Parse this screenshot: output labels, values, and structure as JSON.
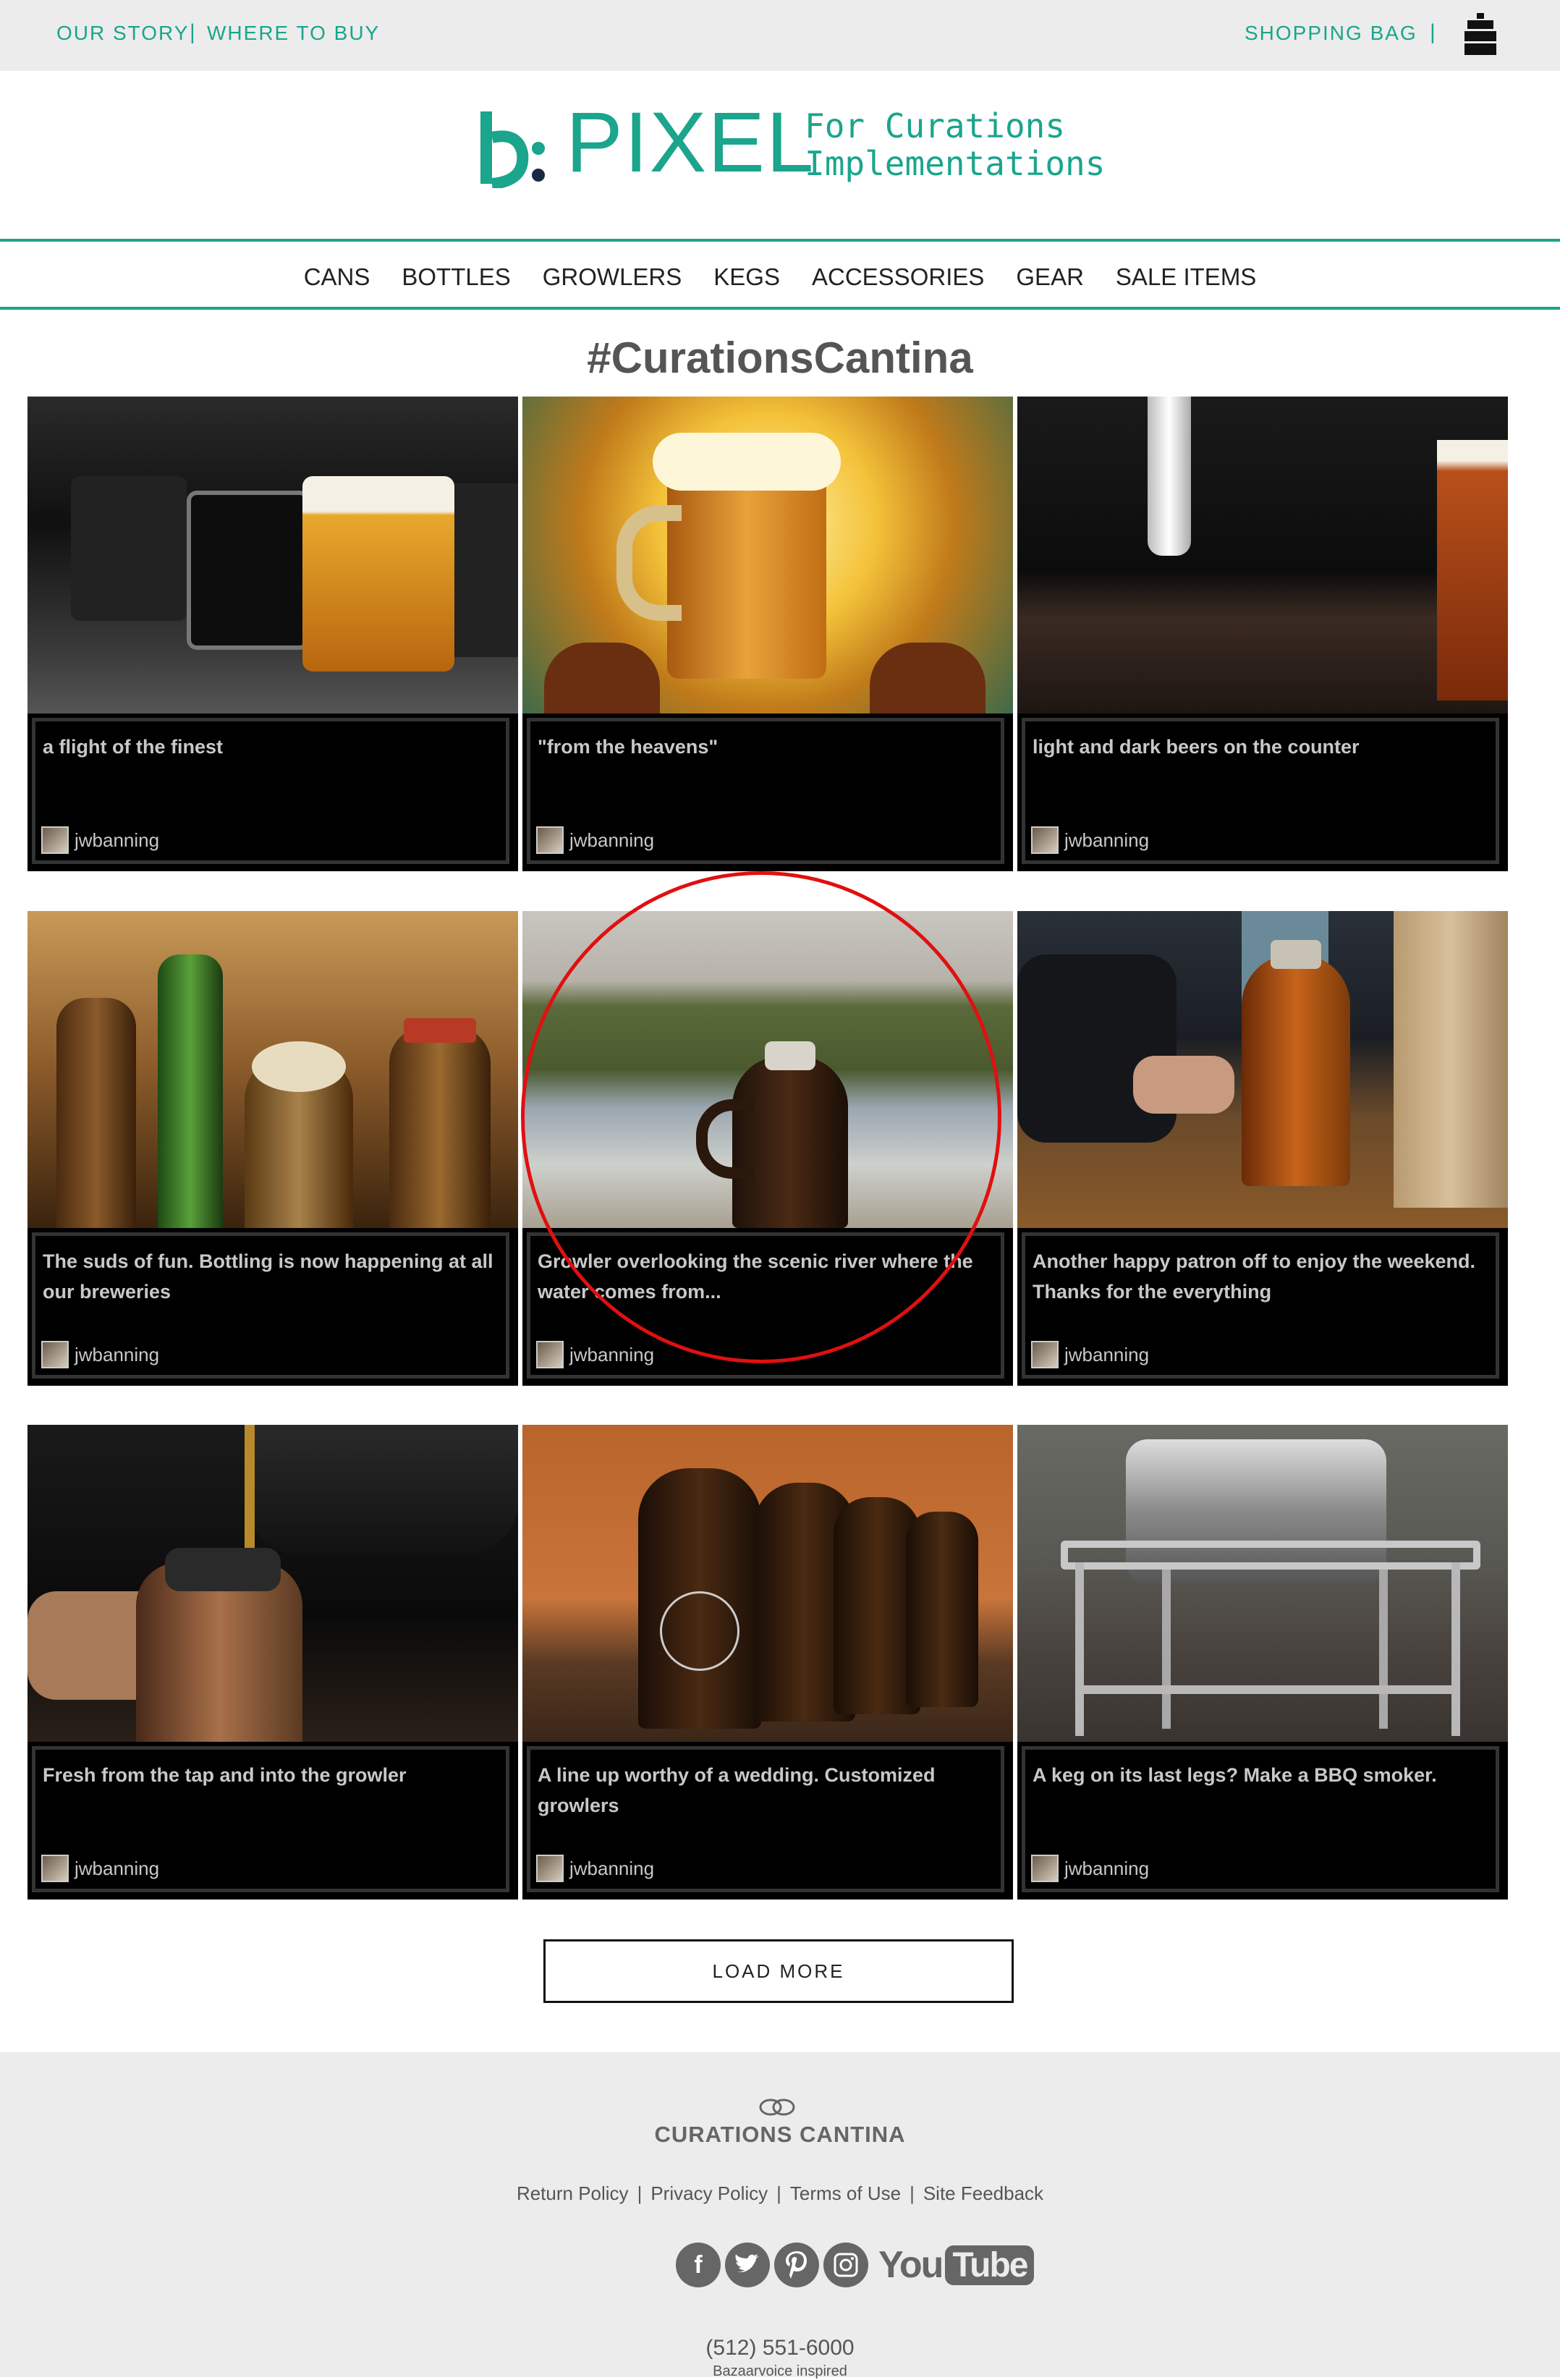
{
  "topbar": {
    "our_story": "OUR STORY",
    "where_to_buy": "WHERE TO BUY",
    "shopping_bag": "SHOPPING BAG",
    "separator": "|"
  },
  "brand": {
    "logo_mark": "b:",
    "name": "PIXEL",
    "tagline_line1": "For Curations",
    "tagline_line2": "Implementations",
    "accent_color": "#1aa58c"
  },
  "nav": {
    "items": [
      "CANS",
      "BOTTLES",
      "GROWLERS",
      "KEGS",
      "ACCESSORIES",
      "GEAR",
      "SALE ITEMS"
    ]
  },
  "gallery": {
    "title": "#CurationsCantina",
    "cards": [
      {
        "caption": "a flight of the finest",
        "author": "jwbanning"
      },
      {
        "caption": "\"from the heavens\"",
        "author": "jwbanning"
      },
      {
        "caption": "light and dark beers on the counter",
        "author": "jwbanning"
      },
      {
        "caption": "The suds of fun. Bottling is now happening at all our breweries",
        "author": "jwbanning"
      },
      {
        "caption": "Growler overlooking the scenic river where the water comes from...",
        "author": "jwbanning"
      },
      {
        "caption": "Another happy patron off to enjoy the weekend. Thanks for the everything",
        "author": "jwbanning"
      },
      {
        "caption": "Fresh from the tap and into the growler",
        "author": "jwbanning"
      },
      {
        "caption": "A line up worthy of a wedding. Customized growlers",
        "author": "jwbanning"
      },
      {
        "caption": "A keg on its last legs? Make a BBQ smoker.",
        "author": "jwbanning"
      }
    ],
    "load_more": "LOAD MORE"
  },
  "footer": {
    "brand": "CURATIONS CANTINA",
    "links": [
      "Return Policy",
      "Privacy Policy",
      "Terms of Use",
      "Site Feedback"
    ],
    "link_separator": "|",
    "social": {
      "facebook": "f",
      "youtube_you": "You",
      "youtube_tube": "Tube"
    },
    "phone": "(512) 551-6000",
    "inspired": "Bazaarvoice inspired"
  },
  "annotation": {
    "highlight_color": "#e01010"
  }
}
